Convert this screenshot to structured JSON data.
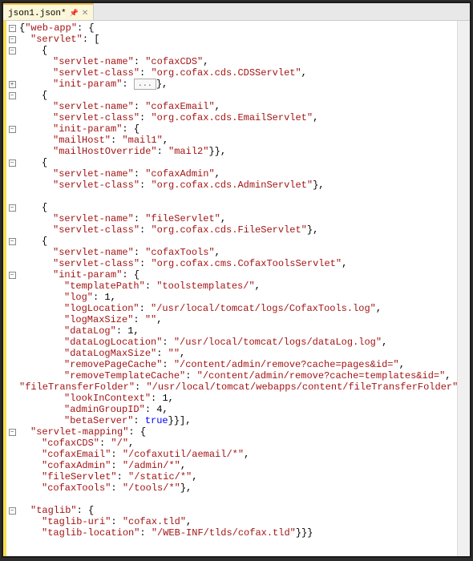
{
  "tab": {
    "title": "json1.json*",
    "pinned": true
  },
  "collapsed_placeholder": "...",
  "json_tree": {
    "web-app": {
      "servlet": [
        {
          "servlet-name": "cofaxCDS",
          "servlet-class": "org.cofax.cds.CDSServlet",
          "init-param": "__COLLAPSED__"
        },
        {
          "servlet-name": "cofaxEmail",
          "servlet-class": "org.cofax.cds.EmailServlet",
          "init-param": {
            "mailHost": "mail1",
            "mailHostOverride": "mail2"
          }
        },
        {
          "servlet-name": "cofaxAdmin",
          "servlet-class": "org.cofax.cds.AdminServlet"
        },
        {
          "servlet-name": "fileServlet",
          "servlet-class": "org.cofax.cds.FileServlet"
        },
        {
          "servlet-name": "cofaxTools",
          "servlet-class": "org.cofax.cms.CofaxToolsServlet",
          "init-param": {
            "templatePath": "toolstemplates/",
            "log": 1,
            "logLocation": "/usr/local/tomcat/logs/CofaxTools.log",
            "logMaxSize": "",
            "dataLog": 1,
            "dataLogLocation": "/usr/local/tomcat/logs/dataLog.log",
            "dataLogMaxSize": "",
            "removePageCache": "/content/admin/remove?cache=pages&id=",
            "removeTemplateCache": "/content/admin/remove?cache=templates&id=",
            "fileTransferFolder": "/usr/local/tomcat/webapps/content/fileTransferFolder",
            "lookInContext": 1,
            "adminGroupID": 4,
            "betaServer": true
          }
        }
      ],
      "servlet-mapping": {
        "cofaxCDS": "/",
        "cofaxEmail": "/cofaxutil/aemail/*",
        "cofaxAdmin": "/admin/*",
        "fileServlet": "/static/*",
        "cofaxTools": "/tools/*"
      },
      "taglib": {
        "taglib-uri": "cofax.tld",
        "taglib-location": "/WEB-INF/tlds/cofax.tld"
      }
    }
  }
}
